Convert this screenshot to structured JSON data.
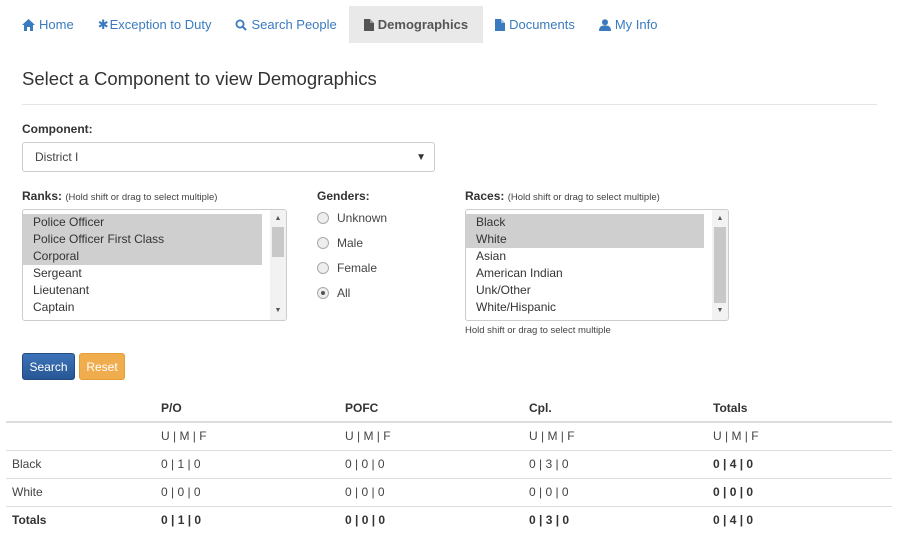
{
  "nav": [
    {
      "label": "Home",
      "icon": "home-icon"
    },
    {
      "label": "Exception to Duty",
      "icon": "asterisk-icon"
    },
    {
      "label": "Search People",
      "icon": "search-icon"
    },
    {
      "label": "Demographics",
      "icon": "file-icon",
      "active": true
    },
    {
      "label": "Documents",
      "icon": "file-icon"
    },
    {
      "label": "My Info",
      "icon": "user-icon"
    }
  ],
  "title": "Select a Component to view Demographics",
  "component": {
    "label": "Component:",
    "value": "District I"
  },
  "ranks": {
    "label": "Ranks:",
    "hint": "(Hold shift or drag to select multiple)",
    "options": [
      "Police Officer",
      "Police Officer First Class",
      "Corporal",
      "Sergeant",
      "Lieutenant",
      "Captain"
    ],
    "selected": [
      0,
      1,
      2
    ]
  },
  "genders": {
    "label": "Genders:",
    "options": [
      "Unknown",
      "Male",
      "Female",
      "All"
    ],
    "checked": 3
  },
  "races": {
    "label": "Races:",
    "hint": "(Hold shift or drag to select multiple)",
    "options": [
      "Black",
      "White",
      "Asian",
      "American Indian",
      "Unk/Other",
      "White/Hispanic"
    ],
    "selected": [
      0,
      1
    ],
    "help": "Hold shift or drag to select multiple"
  },
  "buttons": {
    "search": "Search",
    "reset": "Reset"
  },
  "table": {
    "headers": [
      "",
      "P/O",
      "POFC",
      "Cpl.",
      "Totals"
    ],
    "sub": [
      "",
      "U | M | F",
      "U | M | F",
      "U | M | F",
      "U | M | F"
    ],
    "rows": [
      [
        "Black",
        "0 | 1 | 0",
        "0 | 0 | 0",
        "0 | 3 | 0",
        "0 | 4 | 0"
      ],
      [
        "White",
        "0 | 0 | 0",
        "0 | 0 | 0",
        "0 | 0 | 0",
        "0 | 0 | 0"
      ]
    ],
    "totals": [
      "Totals",
      "0 | 1 | 0",
      "0 | 0 | 0",
      "0 | 3 | 0",
      "0 | 4 | 0"
    ]
  },
  "colors": {
    "link": "#3a7bc0",
    "primary": "#2f64a6",
    "warning": "#f0ad4e"
  }
}
